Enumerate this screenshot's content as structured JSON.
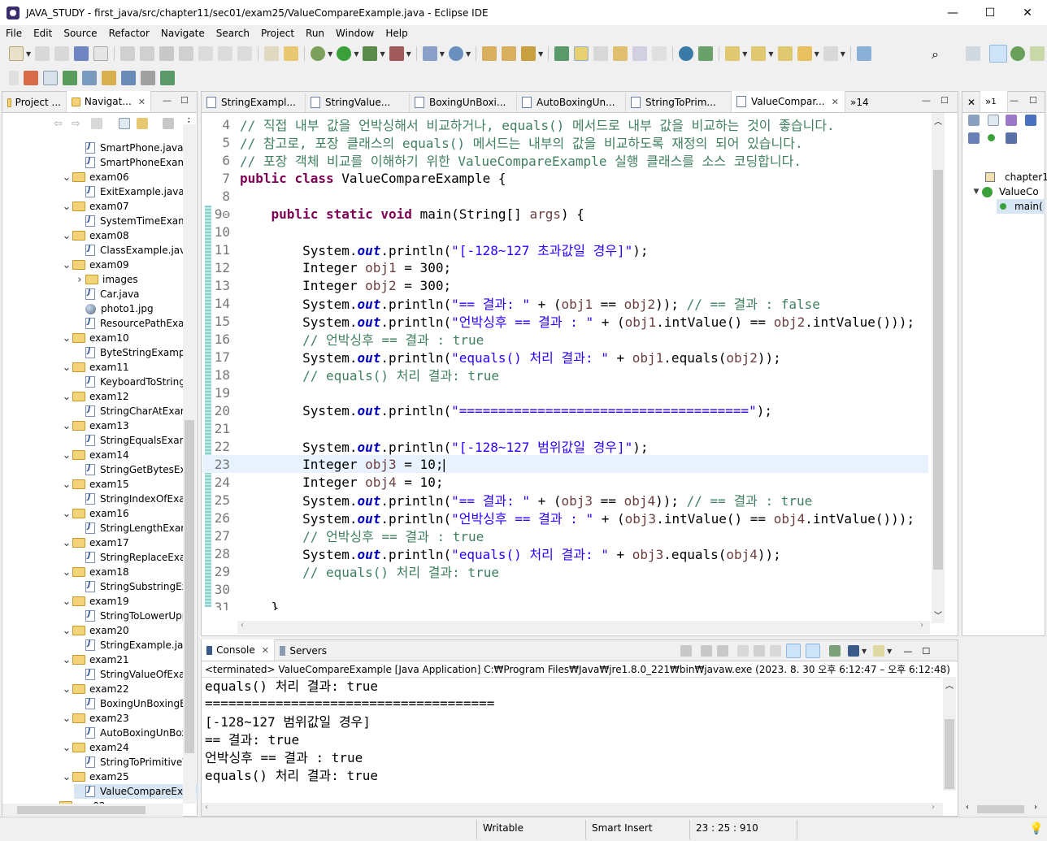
{
  "window": {
    "title": "JAVA_STUDY - first_java/src/chapter11/sec01/exam25/ValueCompareExample.java - Eclipse IDE",
    "minimize": "—",
    "maximize": "☐",
    "close": "✕"
  },
  "menu": [
    "File",
    "Edit",
    "Source",
    "Refactor",
    "Navigate",
    "Search",
    "Project",
    "Run",
    "Window",
    "Help"
  ],
  "explorer": {
    "tabs": [
      {
        "label": "Project ..."
      },
      {
        "label": "Navigat..."
      }
    ],
    "tree": [
      {
        "label": "SmartPhone.java",
        "type": "java",
        "level": 2
      },
      {
        "label": "SmartPhoneExamp",
        "type": "java",
        "level": 2
      },
      {
        "label": "exam06",
        "type": "folder",
        "level": 1,
        "expanded": true
      },
      {
        "label": "ExitExample.java",
        "type": "java",
        "level": 2
      },
      {
        "label": "exam07",
        "type": "folder",
        "level": 1,
        "expanded": true
      },
      {
        "label": "SystemTimeExamp",
        "type": "java",
        "level": 2
      },
      {
        "label": "exam08",
        "type": "folder",
        "level": 1,
        "expanded": true
      },
      {
        "label": "ClassExample.java",
        "type": "java",
        "level": 2
      },
      {
        "label": "exam09",
        "type": "folder",
        "level": 1,
        "expanded": true
      },
      {
        "label": "images",
        "type": "folder",
        "level": 2,
        "expanded": false
      },
      {
        "label": "Car.java",
        "type": "java",
        "level": 2
      },
      {
        "label": "photo1.jpg",
        "type": "image",
        "level": 2
      },
      {
        "label": "ResourcePathExam",
        "type": "java",
        "level": 2
      },
      {
        "label": "exam10",
        "type": "folder",
        "level": 1,
        "expanded": true
      },
      {
        "label": "ByteStringExample",
        "type": "java",
        "level": 2
      },
      {
        "label": "exam11",
        "type": "folder",
        "level": 1,
        "expanded": true
      },
      {
        "label": "KeyboardToStringE",
        "type": "java",
        "level": 2
      },
      {
        "label": "exam12",
        "type": "folder",
        "level": 1,
        "expanded": true
      },
      {
        "label": "StringCharAtExam",
        "type": "java",
        "level": 2
      },
      {
        "label": "exam13",
        "type": "folder",
        "level": 1,
        "expanded": true
      },
      {
        "label": "StringEqualsExamp",
        "type": "java",
        "level": 2
      },
      {
        "label": "exam14",
        "type": "folder",
        "level": 1,
        "expanded": true
      },
      {
        "label": "StringGetBytesExar",
        "type": "java",
        "level": 2
      },
      {
        "label": "exam15",
        "type": "folder",
        "level": 1,
        "expanded": true
      },
      {
        "label": "StringIndexOfExam",
        "type": "java",
        "level": 2
      },
      {
        "label": "exam16",
        "type": "folder",
        "level": 1,
        "expanded": true
      },
      {
        "label": "StringLengthExam",
        "type": "java",
        "level": 2
      },
      {
        "label": "exam17",
        "type": "folder",
        "level": 1,
        "expanded": true
      },
      {
        "label": "StringReplaceExam",
        "type": "java",
        "level": 2
      },
      {
        "label": "exam18",
        "type": "folder",
        "level": 1,
        "expanded": true
      },
      {
        "label": "StringSubstringExa",
        "type": "java",
        "level": 2
      },
      {
        "label": "exam19",
        "type": "folder",
        "level": 1,
        "expanded": true
      },
      {
        "label": "StringToLowerUpp",
        "type": "java",
        "level": 2
      },
      {
        "label": "exam20",
        "type": "folder",
        "level": 1,
        "expanded": true
      },
      {
        "label": "StringExample.java",
        "type": "java",
        "level": 2
      },
      {
        "label": "exam21",
        "type": "folder",
        "level": 1,
        "expanded": true
      },
      {
        "label": "StringValueOfExam",
        "type": "java",
        "level": 2
      },
      {
        "label": "exam22",
        "type": "folder",
        "level": 1,
        "expanded": true
      },
      {
        "label": "BoxingUnBoxingEx",
        "type": "java",
        "level": 2
      },
      {
        "label": "exam23",
        "type": "folder",
        "level": 1,
        "expanded": true
      },
      {
        "label": "AutoBoxingUnBox",
        "type": "java",
        "level": 2
      },
      {
        "label": "exam24",
        "type": "folder",
        "level": 1,
        "expanded": true
      },
      {
        "label": "StringToPrimitiveV",
        "type": "java",
        "level": 2
      },
      {
        "label": "exam25",
        "type": "folder",
        "level": 1,
        "expanded": true
      },
      {
        "label": "ValueCompareExan",
        "type": "java",
        "level": 2,
        "selected": true
      },
      {
        "label": "sec02",
        "type": "folder",
        "level": 0,
        "expanded": false
      }
    ]
  },
  "editor": {
    "tabs": [
      {
        "label": "StringExampl..."
      },
      {
        "label": "StringValue..."
      },
      {
        "label": "BoxingUnBoxi..."
      },
      {
        "label": "AutoBoxingUn..."
      },
      {
        "label": "StringToPrim..."
      },
      {
        "label": "ValueCompar...",
        "active": true
      }
    ],
    "overflow_label": "»14",
    "lines": [
      {
        "n": "4",
        "text": "// 직접 내부 값을 언박싱해서 비교하거나, equals() 메서드로 내부 값을 비교하는 것이 좋습니다."
      },
      {
        "n": "5",
        "text": "// 참고로, 포장 클래스의 equals() 메서드는 내부의 값을 비교하도록 재정의 되어 있습니다."
      },
      {
        "n": "6",
        "text": "// 포장 객체 비교를 이해하기 위한 ValueCompareExample 실행 클래스를 소스 코딩합니다."
      },
      {
        "n": "7",
        "text": "public class ValueCompareExample {"
      },
      {
        "n": "8",
        "text": ""
      },
      {
        "n": "9⊖",
        "text": "    public static void main(String[] args) {"
      },
      {
        "n": "10",
        "text": ""
      },
      {
        "n": "11",
        "text": "        System.out.println(\"[-128~127 초과값일 경우]\");"
      },
      {
        "n": "12",
        "text": "        Integer obj1 = 300;"
      },
      {
        "n": "13",
        "text": "        Integer obj2 = 300;"
      },
      {
        "n": "14",
        "text": "        System.out.println(\"== 결과: \" + (obj1 == obj2)); // == 결과 : false"
      },
      {
        "n": "15",
        "text": "        System.out.println(\"언박싱후 == 결과 : \" + (obj1.intValue() == obj2.intValue()));"
      },
      {
        "n": "16",
        "text": "        // 언박싱후 == 결과 : true"
      },
      {
        "n": "17",
        "text": "        System.out.println(\"equals() 처리 결과: \" + obj1.equals(obj2));"
      },
      {
        "n": "18",
        "text": "        // equals() 처리 결과: true"
      },
      {
        "n": "19",
        "text": ""
      },
      {
        "n": "20",
        "text": "        System.out.println(\"=====================================\");"
      },
      {
        "n": "21",
        "text": ""
      },
      {
        "n": "22",
        "text": "        System.out.println(\"[-128~127 범위값일 경우]\");"
      },
      {
        "n": "23",
        "text": "        Integer obj3 = 10;",
        "current": true
      },
      {
        "n": "24",
        "text": "        Integer obj4 = 10;"
      },
      {
        "n": "25",
        "text": "        System.out.println(\"== 결과: \" + (obj3 == obj4)); // == 결과 : true"
      },
      {
        "n": "26",
        "text": "        System.out.println(\"언박싱후 == 결과 : \" + (obj3.intValue() == obj4.intValue()));"
      },
      {
        "n": "27",
        "text": "        // 언박싱후 == 결과 : true"
      },
      {
        "n": "28",
        "text": "        System.out.println(\"equals() 처리 결과: \" + obj3.equals(obj4));"
      },
      {
        "n": "29",
        "text": "        // equals() 처리 결과: true"
      },
      {
        "n": "30",
        "text": ""
      },
      {
        "n": "31",
        "text": "    }"
      }
    ]
  },
  "outline": {
    "tab_label": "1",
    "items": [
      {
        "label": "chapter1"
      },
      {
        "label": "ValueCo"
      },
      {
        "label": "main("
      }
    ]
  },
  "console": {
    "tabs": [
      {
        "label": "Console"
      },
      {
        "label": "Servers"
      }
    ],
    "header": "<terminated> ValueCompareExample [Java Application] C:₩Program Files₩Java₩jre1.8.0_221₩bin₩javaw.exe  (2023. 8. 30 오후 6:12:47 – 오후 6:12:48)",
    "lines": [
      "equals() 처리 결과: true",
      "=====================================",
      "[-128~127 범위값일 경우]",
      "== 결과: true",
      "언박싱후 == 결과 : true",
      "equals() 처리 결과: true"
    ]
  },
  "status": {
    "writable": "Writable",
    "insert_mode": "Smart Insert",
    "position": "23 : 25 : 910"
  },
  "colors": {
    "keyword": "#7f0055",
    "string": "#2a00ff",
    "comment": "#3f7f5f",
    "field": "#0000c0",
    "current_line": "#e8f2fe"
  }
}
